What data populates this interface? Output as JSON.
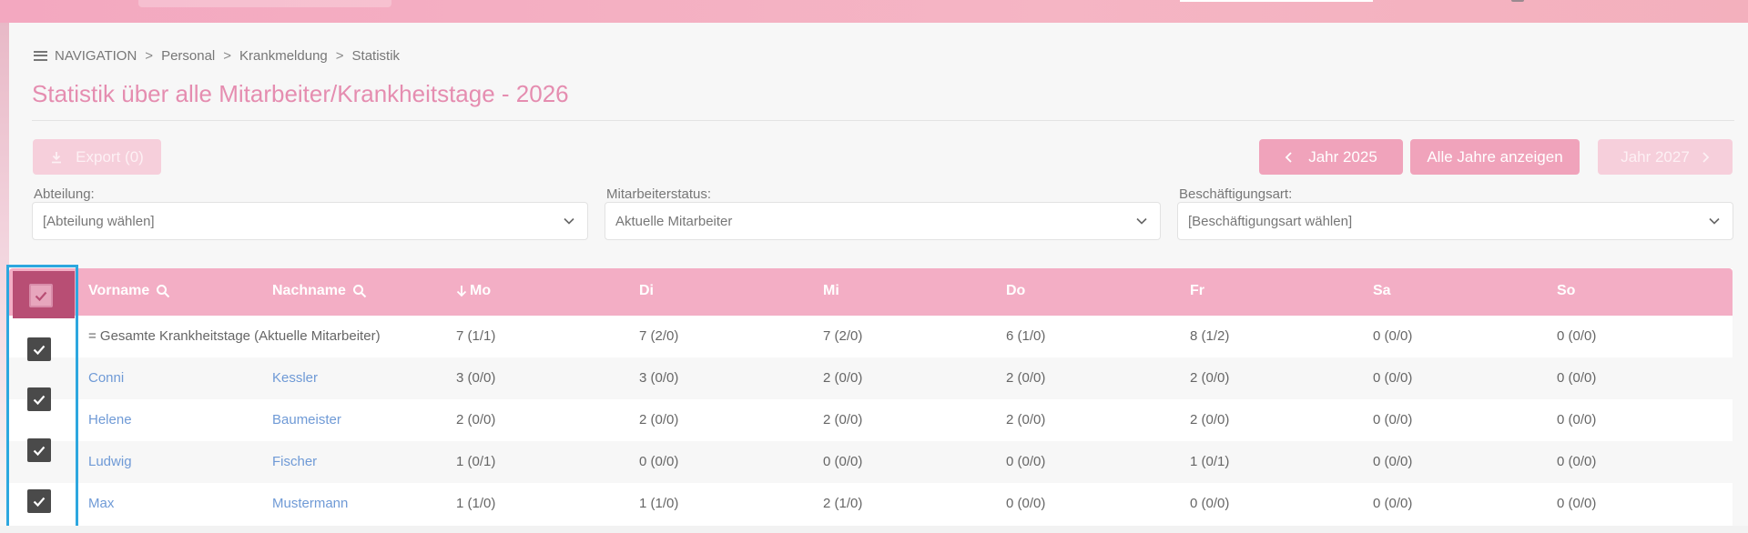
{
  "breadcrumb": {
    "nav_label": "NAVIGATION",
    "items": [
      "Personal",
      "Krankmeldung",
      "Statistik"
    ],
    "separator": ">"
  },
  "page": {
    "title": "Statistik über alle Mitarbeiter/Krankheitstage - 2026"
  },
  "toolbar": {
    "export_label": "Export (0)",
    "prev_year_label": "Jahr 2025",
    "all_years_label": "Alle Jahre anzeigen",
    "next_year_label": "Jahr 2027"
  },
  "filters": {
    "department": {
      "label": "Abteilung:",
      "value": "[Abteilung wählen]"
    },
    "status": {
      "label": "Mitarbeiterstatus:",
      "value": "Aktuelle Mitarbeiter"
    },
    "employment": {
      "label": "Beschäftigungsart:",
      "value": "[Beschäftigungsart wählen]"
    }
  },
  "table": {
    "headers": {
      "firstname": "Vorname",
      "lastname": "Nachname",
      "mo": "Mo",
      "di": "Di",
      "mi": "Mi",
      "do": "Do",
      "fr": "Fr",
      "sa": "Sa",
      "so": "So"
    },
    "summary": {
      "label": "= Gesamte Krankheitstage (Aktuelle Mitarbeiter)",
      "values": [
        "7 (1/1)",
        "7 (2/0)",
        "7 (2/0)",
        "6 (1/0)",
        "8 (1/2)",
        "0 (0/0)",
        "0 (0/0)"
      ]
    },
    "rows": [
      {
        "firstname": "Conni",
        "lastname": "Kessler",
        "values": [
          "3 (0/0)",
          "3 (0/0)",
          "2 (0/0)",
          "2 (0/0)",
          "2 (0/0)",
          "0 (0/0)",
          "0 (0/0)"
        ]
      },
      {
        "firstname": "Helene",
        "lastname": "Baumeister",
        "values": [
          "2 (0/0)",
          "2 (0/0)",
          "2 (0/0)",
          "2 (0/0)",
          "2 (0/0)",
          "0 (0/0)",
          "0 (0/0)"
        ]
      },
      {
        "firstname": "Ludwig",
        "lastname": "Fischer",
        "values": [
          "1 (0/1)",
          "0 (0/0)",
          "0 (0/0)",
          "0 (0/0)",
          "1 (0/1)",
          "0 (0/0)",
          "0 (0/0)"
        ]
      },
      {
        "firstname": "Max",
        "lastname": "Mustermann",
        "values": [
          "1 (1/0)",
          "1 (1/0)",
          "2 (1/0)",
          "0 (0/0)",
          "0 (0/0)",
          "0 (0/0)",
          "0 (0/0)"
        ]
      }
    ]
  },
  "icons": {
    "menu": "hamburger-icon",
    "export": "download-icon",
    "prev": "chevron-left-icon",
    "next": "chevron-right-icon",
    "search": "search-icon",
    "sort": "arrow-down-icon",
    "dropdown": "chevron-down-icon",
    "checkbox": "check-icon"
  },
  "colors": {
    "accent": "#f0a3bb",
    "title": "#e58db0",
    "link": "#6f9ad6",
    "highlight": "#2da7df"
  }
}
